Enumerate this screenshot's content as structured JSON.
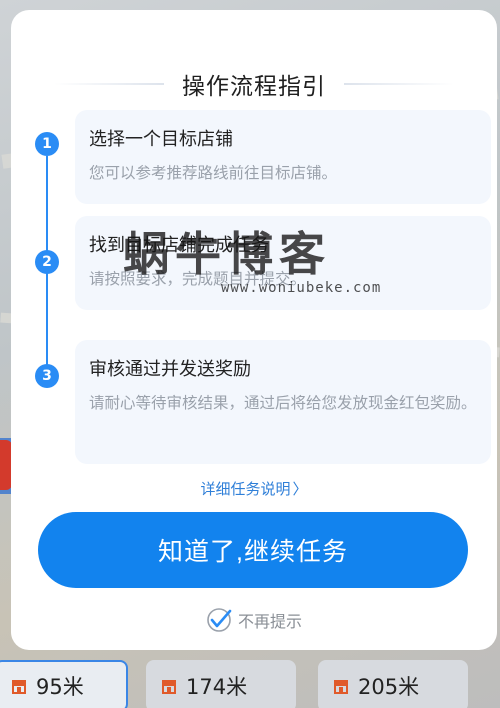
{
  "dialog": {
    "title": "操作流程指引",
    "steps": [
      {
        "number": "1",
        "title": "选择一个目标店铺",
        "desc": "您可以参考推荐路线前往目标店铺。"
      },
      {
        "number": "2",
        "title": "找到目标店铺完成任务",
        "desc": "请按照要求，完成题目并提交。"
      },
      {
        "number": "3",
        "title": "审核通过并发送奖励",
        "desc": "请耐心等待审核结果，通过后将给您发放现金红包奖励。"
      }
    ],
    "detail_link": "详细任务说明",
    "detail_chevron": "〉",
    "primary_button": "知道了,继续任务",
    "no_remind_label": "不再提示",
    "no_remind_checked": true
  },
  "watermark": {
    "text": "蜗牛博客",
    "url": "www.woniubeke.com"
  },
  "bottom_stores": [
    {
      "distance": "95米",
      "selected": true
    },
    {
      "distance": "174米",
      "selected": false
    },
    {
      "distance": "205米",
      "selected": false
    }
  ],
  "colors": {
    "accent": "#1283ee",
    "step_card_bg": "#f3f7fd",
    "muted_text": "#9aa1ab"
  }
}
